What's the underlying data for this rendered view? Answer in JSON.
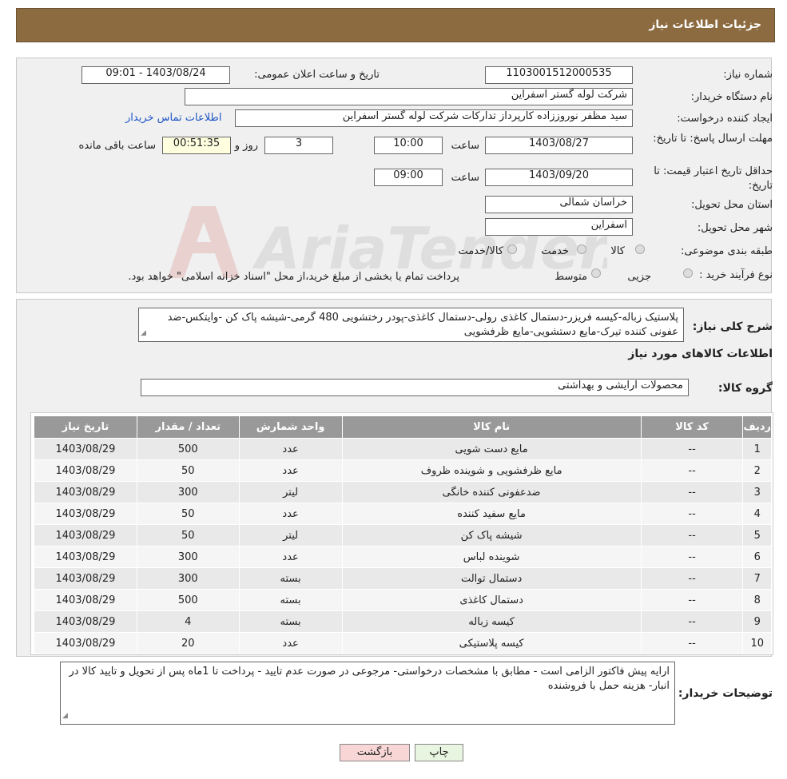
{
  "header": {
    "title": "جزئیات اطلاعات نیاز"
  },
  "form": {
    "need_number_label": "شماره نیاز:",
    "need_number": "1103001512000535",
    "announce_label": "تاریخ و ساعت اعلان عمومی:",
    "announce_value": "1403/08/24 - 09:01",
    "buyer_label": "نام دستگاه خریدار:",
    "buyer_value": "شرکت لوله گستر اسفراین",
    "creator_label": "ایجاد کننده درخواست:",
    "creator_value": "سید مظفر نوروززاده کارپرداز تدارکات شرکت لوله گستر اسفراین",
    "contact_link": "اطلاعات تماس خریدار",
    "deadline_label": "مهلت ارسال پاسخ: تا تاریخ:",
    "deadline_date": "1403/08/27",
    "time_label": "ساعت",
    "deadline_time": "10:00",
    "days_value": "3",
    "days_label": "روز و",
    "remaining_time": "00:51:35",
    "remaining_label": "ساعت باقی مانده",
    "validity_label": "حداقل تاریخ اعتبار قیمت: تا تاریخ:",
    "validity_date": "1403/09/20",
    "validity_time": "09:00",
    "province_label": "استان محل تحویل:",
    "province_value": "خراسان شمالی",
    "city_label": "شهر محل تحویل:",
    "city_value": "اسفراین",
    "category_label": "طبقه بندی موضوعی:",
    "category_options": [
      "کالا",
      "خدمت",
      "کالا/خدمت"
    ],
    "process_label": "نوع فرآیند خرید :",
    "process_options": [
      "جزیی",
      "متوسط"
    ],
    "process_note": "پرداخت تمام یا بخشی از مبلغ خرید،از محل \"اسناد خزانه اسلامی\" خواهد بود."
  },
  "summary": {
    "label": "شرح کلی نیاز:",
    "text": "پلاستیک زباله-کیسه فریزر-دستمال کاغذی رولی-دستمال کاغذی-پودر رختشویی 480 گرمی-شیشه پاک کن -وایتکس-ضد عفونی کننده تیرک-مایع دستشویی-مایع ظرفشویی"
  },
  "goods": {
    "section_title": "اطلاعات کالاهای مورد نیاز",
    "group_label": "گروه کالا:",
    "group_value": "محصولات آرایشی و بهداشتی",
    "columns": [
      "ردیف",
      "کد کالا",
      "نام کالا",
      "واحد شمارش",
      "تعداد / مقدار",
      "تاریخ نیاز"
    ],
    "rows": [
      [
        "1",
        "--",
        "مایع دست شویی",
        "عدد",
        "500",
        "1403/08/29"
      ],
      [
        "2",
        "--",
        "مایع ظرفشویی و شوینده ظروف",
        "عدد",
        "50",
        "1403/08/29"
      ],
      [
        "3",
        "--",
        "ضدعفونی کننده خانگی",
        "لیتر",
        "300",
        "1403/08/29"
      ],
      [
        "4",
        "--",
        "مایع سفید کننده",
        "عدد",
        "50",
        "1403/08/29"
      ],
      [
        "5",
        "--",
        "شیشه پاک کن",
        "لیتر",
        "50",
        "1403/08/29"
      ],
      [
        "6",
        "--",
        "شوینده لباس",
        "عدد",
        "300",
        "1403/08/29"
      ],
      [
        "7",
        "--",
        "دستمال توالت",
        "بسته",
        "300",
        "1403/08/29"
      ],
      [
        "8",
        "--",
        "دستمال کاغذی",
        "بسته",
        "500",
        "1403/08/29"
      ],
      [
        "9",
        "--",
        "کیسه زباله",
        "بسته",
        "4",
        "1403/08/29"
      ],
      [
        "10",
        "--",
        "کیسه پلاستیکی",
        "عدد",
        "20",
        "1403/08/29"
      ]
    ]
  },
  "buyer_notes": {
    "label": "توضیحات خریدار:",
    "text": "ارایه پیش فاکتور الزامی است - مطابق با مشخصات درخواستی- مرجوعی در صورت عدم تایید - پرداخت تا 1ماه پس از تحویل و تایید کالا در انبار- هزینه حمل با فروشنده"
  },
  "buttons": {
    "print": "چاپ",
    "back": "بازگشت"
  },
  "watermark": {
    "text": "AriaTender.neT"
  },
  "colors": {
    "header": "#8c6b40",
    "link": "#1f55c8",
    "table_header": "#999999",
    "back_button": "#f8d6d6"
  }
}
